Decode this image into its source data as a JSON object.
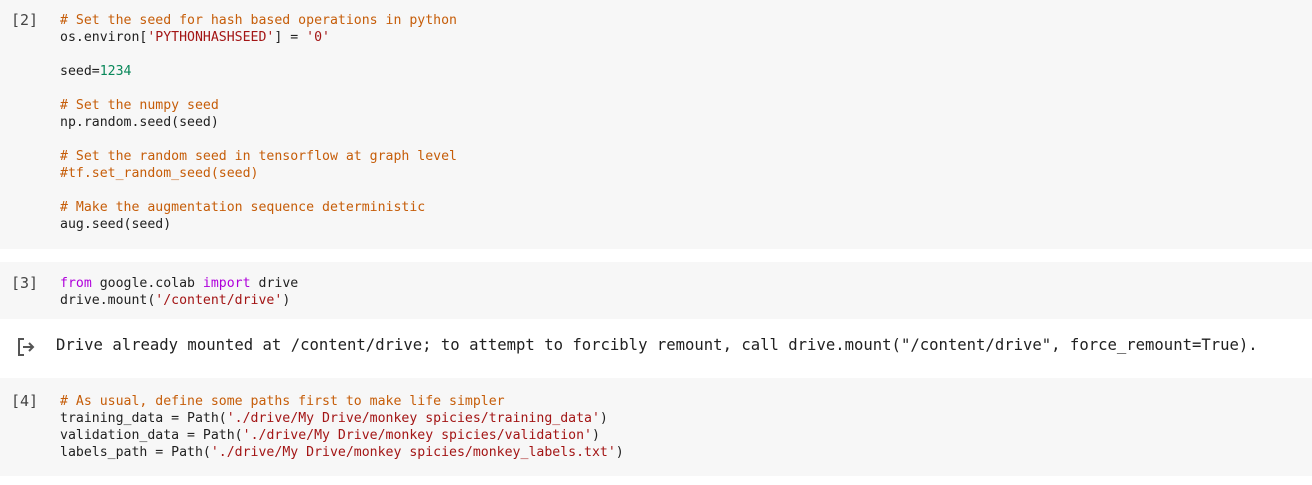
{
  "cells": [
    {
      "exec_count": "[2]",
      "lines": [
        {
          "segments": [
            {
              "t": "comment",
              "text": "# Set the seed for hash based operations in python"
            }
          ]
        },
        {
          "segments": [
            {
              "t": "plain",
              "text": "os.environ["
            },
            {
              "t": "string",
              "text": "'PYTHONHASHSEED'"
            },
            {
              "t": "plain",
              "text": "] = "
            },
            {
              "t": "string",
              "text": "'0'"
            }
          ]
        },
        {
          "blank": true
        },
        {
          "segments": [
            {
              "t": "plain",
              "text": "seed="
            },
            {
              "t": "number",
              "text": "1234"
            }
          ]
        },
        {
          "blank": true
        },
        {
          "segments": [
            {
              "t": "comment",
              "text": "# Set the numpy seed"
            }
          ]
        },
        {
          "segments": [
            {
              "t": "plain",
              "text": "np.random.seed(seed)"
            }
          ]
        },
        {
          "blank": true
        },
        {
          "segments": [
            {
              "t": "comment",
              "text": "# Set the random seed in tensorflow at graph level"
            }
          ]
        },
        {
          "segments": [
            {
              "t": "comment",
              "text": "#tf.set_random_seed(seed)"
            }
          ]
        },
        {
          "blank": true
        },
        {
          "segments": [
            {
              "t": "comment",
              "text": "# Make the augmentation sequence deterministic"
            }
          ]
        },
        {
          "segments": [
            {
              "t": "plain",
              "text": "aug.seed(seed)"
            }
          ]
        }
      ]
    },
    {
      "exec_count": "[3]",
      "lines": [
        {
          "segments": [
            {
              "t": "keyword",
              "text": "from"
            },
            {
              "t": "plain",
              "text": " google.colab "
            },
            {
              "t": "keyword",
              "text": "import"
            },
            {
              "t": "plain",
              "text": " drive"
            }
          ]
        },
        {
          "segments": [
            {
              "t": "plain",
              "text": "drive.mount("
            },
            {
              "t": "string",
              "text": "'/content/drive'"
            },
            {
              "t": "plain",
              "text": ")"
            }
          ]
        }
      ]
    },
    {
      "exec_count": "[4]",
      "lines": [
        {
          "segments": [
            {
              "t": "comment",
              "text": "# As usual, define some paths first to make life simpler"
            }
          ]
        },
        {
          "segments": [
            {
              "t": "plain",
              "text": "training_data = Path("
            },
            {
              "t": "string",
              "text": "'./drive/My Drive/monkey spicies/training_data'"
            },
            {
              "t": "plain",
              "text": ")"
            }
          ]
        },
        {
          "segments": [
            {
              "t": "plain",
              "text": "validation_data = Path("
            },
            {
              "t": "string",
              "text": "'./drive/My Drive/monkey spicies/validation'"
            },
            {
              "t": "plain",
              "text": ")"
            }
          ]
        },
        {
          "segments": [
            {
              "t": "plain",
              "text": "labels_path = Path("
            },
            {
              "t": "string",
              "text": "'./drive/My Drive/monkey spicies/monkey_labels.txt'"
            },
            {
              "t": "plain",
              "text": ")"
            }
          ]
        }
      ]
    }
  ],
  "output": {
    "icon": "output-arrow-icon",
    "text": "Drive already mounted at /content/drive; to attempt to forcibly remount, call drive.mount(\"/content/drive\", force_remount=True)."
  },
  "colors": {
    "comment": "#c65d09",
    "string": "#a31515",
    "number": "#09885a",
    "keyword": "#af00db",
    "cell_bg": "#f7f7f7"
  }
}
